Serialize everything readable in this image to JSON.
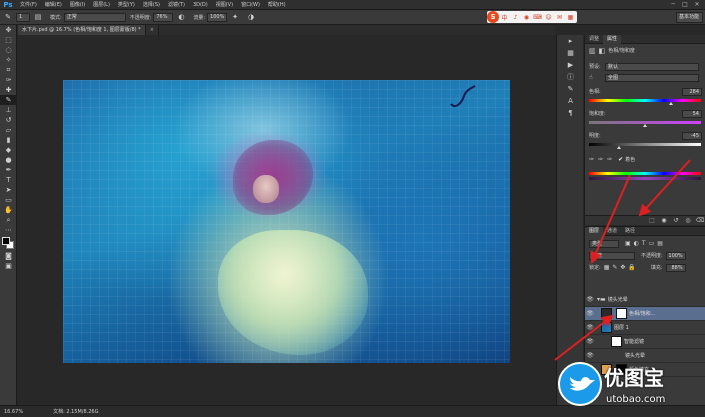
{
  "menubar": {
    "logo": "Ps",
    "items": [
      "文件(F)",
      "编辑(E)",
      "图像(I)",
      "图层(L)",
      "类型(Y)",
      "选择(S)",
      "滤镜(T)",
      "3D(D)",
      "视图(V)",
      "窗口(W)",
      "帮助(H)"
    ],
    "win_min": "─",
    "win_max": "□",
    "win_close": "✕"
  },
  "options": {
    "mode_label": "模式:",
    "mode_value": "正常",
    "opacity_label": "不透明度:",
    "opacity_value": "76%",
    "flow_label": "流量:",
    "flow_value": "100%",
    "brush_size": "1"
  },
  "sogou": {
    "logo": "S",
    "items": [
      "中",
      "♪",
      "◉",
      "⌨",
      "☺",
      "✉",
      "▦",
      "✂"
    ]
  },
  "workspace": "基本功能",
  "doc_tabs": [
    {
      "label": "水下片.psd @ 16.7% (色相/饱和度 1, 图层蒙版/8) *",
      "active": true
    },
    {
      "label": "×",
      "active": false
    }
  ],
  "properties": {
    "tab_properties": "属性",
    "tab_adjust": "调整",
    "title": "色相/饱和度",
    "preset_label": "预设:",
    "preset_value": "默认",
    "channel_value": "全图",
    "hue_label": "色相:",
    "hue_value": "284",
    "saturation_label": "饱和度:",
    "saturation_value": "54",
    "lightness_label": "明度:",
    "lightness_value": "-45",
    "colorize_label": "着色",
    "colorize_checked": "✔"
  },
  "layers_panel": {
    "tab_layers": "图层",
    "tab_channels": "通道",
    "tab_paths": "路径",
    "kind_value": "类型",
    "blend_value": "正常",
    "opacity_label": "不透明度:",
    "opacity_value": "100%",
    "lock_label": "锁定:",
    "fill_label": "填充:",
    "fill_value": "88%",
    "layers": [
      {
        "name": "镜头光晕",
        "type": "group"
      },
      {
        "name": "色相/饱和...",
        "type": "adjustment",
        "selected": true
      },
      {
        "name": "图层 1",
        "type": "pixel"
      },
      {
        "name": "智能滤镜",
        "type": "filter"
      },
      {
        "name": "镜头光晕",
        "type": "filter-item"
      },
      {
        "name": "颜色填充 1",
        "type": "fill"
      }
    ]
  },
  "status": {
    "zoom": "16.67%",
    "doc_info": "文档: 2.15M/8.26G"
  },
  "watermark": {
    "text": "优图宝",
    "url": "utobao.com"
  },
  "colors": {
    "accent": "#3aa8ff",
    "arrow": "#e02020"
  }
}
